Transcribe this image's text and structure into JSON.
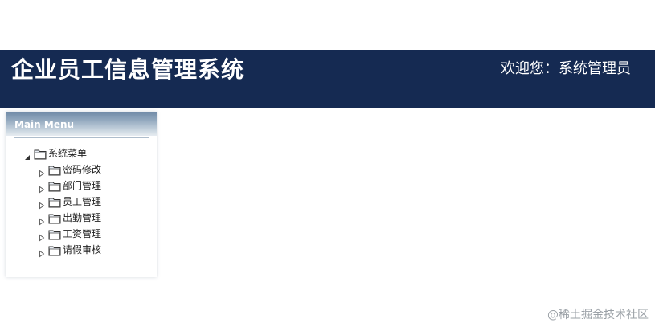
{
  "header": {
    "title": "企业员工信息管理系统",
    "welcome": "欢迎您：系统管理员",
    "background": "#152a52"
  },
  "menu": {
    "title": "Main Menu",
    "root": {
      "label": "系统菜单",
      "expanded": true,
      "icon": "folder-icon"
    },
    "items": [
      {
        "label": "密码修改",
        "icon": "folder-icon"
      },
      {
        "label": "部门管理",
        "icon": "folder-icon"
      },
      {
        "label": "员工管理",
        "icon": "folder-icon"
      },
      {
        "label": "出勤管理",
        "icon": "folder-icon"
      },
      {
        "label": "工资管理",
        "icon": "folder-icon"
      },
      {
        "label": "请假审核",
        "icon": "folder-icon"
      }
    ]
  },
  "watermark": "@稀土掘金技术社区"
}
